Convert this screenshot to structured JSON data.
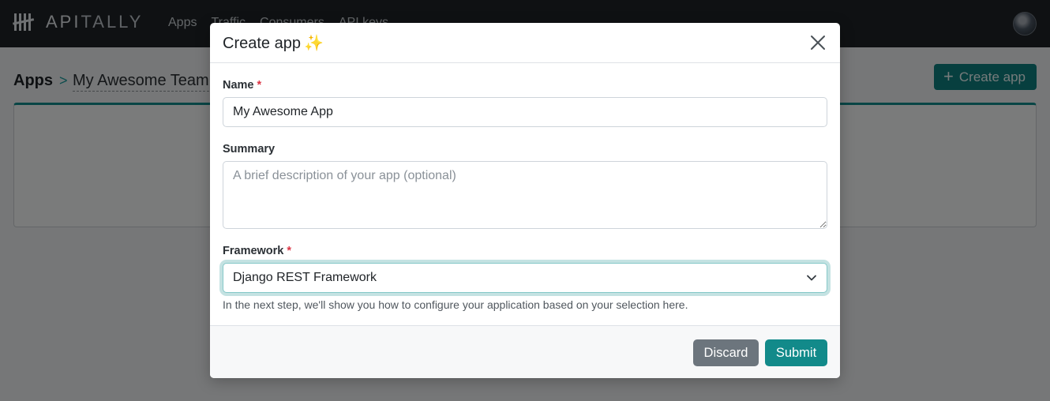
{
  "navbar": {
    "brand": {
      "bold": "API",
      "light": "TALLY"
    },
    "links": [
      "Apps",
      "Traffic",
      "Consumers",
      "API keys"
    ]
  },
  "page": {
    "breadcrumb_root": "Apps",
    "breadcrumb_sep": ">",
    "breadcrumb_team": "My Awesome Team",
    "create_app_button": "Create app"
  },
  "modal": {
    "title": "Create app",
    "title_emoji": "✨",
    "name_label": "Name",
    "name_value": "My Awesome App",
    "summary_label": "Summary",
    "summary_placeholder": "A brief description of your app (optional)",
    "framework_label": "Framework",
    "framework_value": "Django REST Framework",
    "framework_help": "In the next step, we'll show you how to configure your application based on your selection here.",
    "required_marker": "*",
    "discard_button": "Discard",
    "submit_button": "Submit"
  },
  "colors": {
    "accent": "#128a8a",
    "navbar_bg": "#1f2326",
    "discard_bg": "#6c757d",
    "required": "#dc3545"
  },
  "icons": {
    "brand": "apitally-tally-icon",
    "close": "close-icon",
    "chevron": "chevron-down-icon",
    "plus": "plus-icon",
    "breadcrumb_separator": "chevron-right-icon"
  }
}
